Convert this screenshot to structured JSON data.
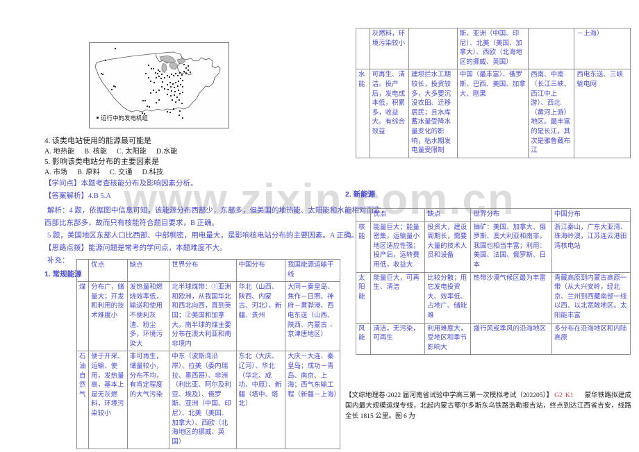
{
  "watermark": {
    "text": "www.zixin.com.cn"
  },
  "figure": {
    "caption": "运行中的发电机组",
    "alt_name": "united-states-power-plant-distribution-map"
  },
  "questions": [
    {
      "number": "4.",
      "stem": "该类电站使用的能源最可能是",
      "options": [
        "A. 地热能",
        "B. 核能",
        "C. 太阳能",
        "D.水能"
      ]
    },
    {
      "number": "5.",
      "stem": "影响该类电站分布的主要因素是",
      "options": [
        "A. 市场",
        "B. 原料",
        "C. 交通",
        "D.科技"
      ]
    }
  ],
  "annotations": {
    "knowledge_point": "【学问点】本题考查核能分布及影响因素分析。",
    "answer_label": "【答案解析】",
    "answers": "4.B     5.A",
    "analysis_line1": "解析：4 题，依据图中信息可知，该能源分布西部少，东部多，但美国的地热能、太阳能和水能相对而言，",
    "analysis_line2": "西部比东部多，故而只有核能符合题目要求，B 正确。",
    "analysis_line3": "5 题，美国地区东部人口比西部、中部稠密，用电量大，是影响核电站分布的主要因素。A 正确。",
    "tip": "【思路点拨】能源问题是常考的学问点，本题难度不大。",
    "supplement": "补充：",
    "section1": "1. 常规能源",
    "section2": "2. 新能源"
  },
  "table_conventional": {
    "headers": [
      "",
      "优点",
      "缺点",
      "世界分布",
      "中国分布",
      "我国能源运输干线"
    ],
    "rows": [
      {
        "label": "煤",
        "cells": [
          "分布广，储量大；开发和利用的技术难度小",
          "发热量和燃烧效率低，输送和使用不便利灰渣、粉尘多，环境污染大",
          "北半球煤带：①亚洲和欧洲，从我国华北和西北向西，直到英国；②美国和加拿大。南半球的煤主要分布在澳大利亚和南非境内",
          "华北（山西、陕西、内蒙古、河北）、新疆、贵州",
          "大同－秦皇岛、焦作－日照、神府－黄骅港、西电东送（山西、陕西、内蒙古→京津唐地区）"
        ]
      },
      {
        "label": "石油自然气",
        "cells": [
          "便于开采、运输、使用，发热量高，基本上是无灰燃料，环境污染较小",
          "非可再生，储量较小，分布不均，有肯定程度的大气污染",
          "中东（波斯湾沿岸）、拉美（委内瑞拉、墨西哥）、非洲（利比亚、阿尔及利亚、埃及）、俄罗斯、亚洲（中国、印尼）、北美（美国、加拿大）、西欧（北海地区的挪威、英国）",
          "东北（大庆、辽河）、华北（华北、成功、中原）、新疆（塔中、塔北）",
          "大庆－大连、秦皇岛；成功－青岛、南京、上海；西气东输工程（新疆－上海）"
        ]
      },
      {
        "label": "水能",
        "cells": [
          "可再生、清洁。投产后，发电成本低，积累多，收益大。有综合效益",
          "建坝拦水工期较长，投资较多，大多要沉没农田、迁移居民；且水库蓄水量受降水量变化的影响，枯水期发电量受限制",
          "中国（最丰富）、俄罗斯、巴西、美国、加拿大、刚果",
          "西南、中南（长江三峡、西江中上游）、西北（黄河上游）地区。最丰富的是长江，其次是雅鲁藏布江",
          "西电东送、三峡输电网"
        ]
      }
    ]
  },
  "table_new_energy": {
    "headers": [
      "",
      "优点",
      "缺点",
      "世界分布",
      "中国分布"
    ],
    "rows": [
      {
        "label": "核能",
        "cells": [
          "能量巨大；能量密集，运输量小地区适应性强；投产后，运转费用低，收益大",
          "投资大，建设周期长，需要大量的技术人员和设备",
          "铀矿：美国、加拿大、俄罗斯、澳大利亚和南非。我国也相当丰富；利用：美国、法国、俄罗斯、日本",
          "浙江秦山，广东大亚湾、珠海岭澳，江苏连云港田湾核电站"
        ]
      },
      {
        "label": "太阳能",
        "cells": [
          "能量巨大，可再生、清洁",
          "比较分散；用它发电投资大、效率低、占地广、储能难",
          "热带沙漠气候区最为丰富",
          "青藏高原到内蒙古高原一带（从大兴安岭，经北京、兰州到西藏南部一线以西、以北宽敞地区。太阳能丰富"
        ]
      },
      {
        "label": "风能",
        "cells": [
          "清洁，无污染，可再生",
          "利用难度大，受地区和季节影响大",
          "盛行风或季风的沿海地区",
          "多分布在沿海地区和内陆高原"
        ]
      }
    ]
  },
  "footer": {
    "prefix": "【文综地理卷·2022 届河南省试验中学高三第一次模拟考试（202205）】",
    "code1": "G2",
    "code2": "K1",
    "body": "蒙华铁路拟建成国内最大规模运煤专线，北起内蒙古鄂尔多斯东乌铁路浩勒报吉站，终点到达江西省吉安，线路全长 1815 公里。图 6 为"
  }
}
